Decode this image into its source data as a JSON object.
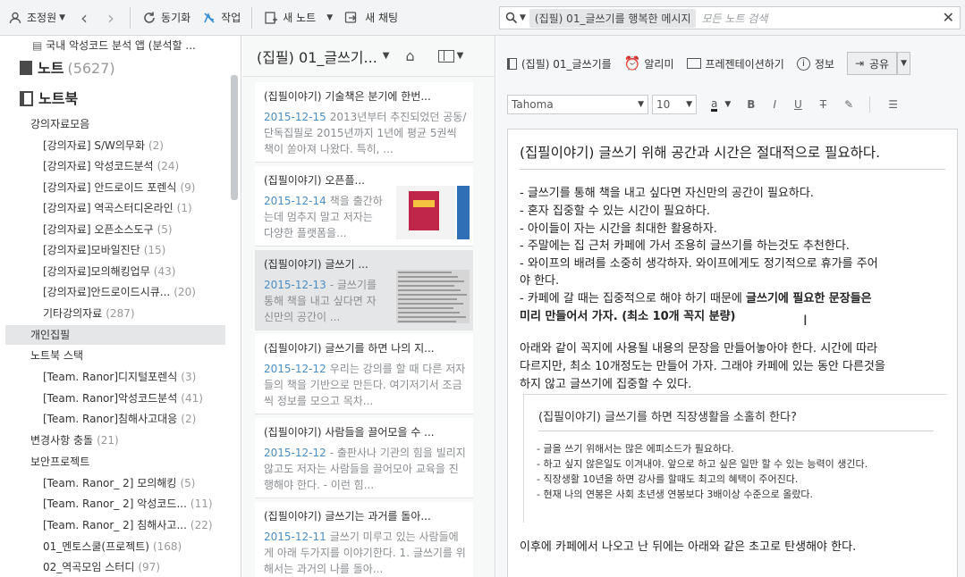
{
  "toolbar": {
    "user": "조정원",
    "sync": "동기화",
    "work": "작업",
    "new_note": "새 노트",
    "new_chat": "새 채팅",
    "search_chip": "(집필) 01_글쓰기를 행복한 메시지",
    "search_placeholder": "모든 노트 검색"
  },
  "sidebar": {
    "top_item": "국내 악성코드 분석 앱 (분석할 ...",
    "notes_label": "노트",
    "notes_count": "(5627)",
    "notebooks_label": "노트북",
    "items": [
      {
        "label": "강의자료모음",
        "count": ""
      },
      {
        "label": "[강의자료] S/W의무화",
        "count": "(2)"
      },
      {
        "label": "[강의자료] 악성코드분석",
        "count": "(24)"
      },
      {
        "label": "[강의자료] 안드로이드 포렌식",
        "count": "(9)"
      },
      {
        "label": "[강의자료] 역곡스터디온라인",
        "count": "(1)"
      },
      {
        "label": "[강의자료] 오픈소스도구",
        "count": "(5)"
      },
      {
        "label": "[강의자료]모바일진단",
        "count": "(15)"
      },
      {
        "label": "[강의자료]모의해킹업무",
        "count": "(43)"
      },
      {
        "label": "[강의자료]안드로이드시큐...",
        "count": "(20)"
      },
      {
        "label": "기타강의자료",
        "count": "(287)"
      },
      {
        "label": "개인집필",
        "count": ""
      },
      {
        "label": "노트북 스택",
        "count": ""
      },
      {
        "label": "[Team. Ranor]디지털포렌식",
        "count": "(3)"
      },
      {
        "label": "[Team. Ranor]악성코드분석",
        "count": "(41)"
      },
      {
        "label": "[Team. Ranor]침해사고대응",
        "count": "(2)"
      },
      {
        "label": "변경사항 충돌",
        "count": "(21)"
      },
      {
        "label": "보안프로젝트",
        "count": ""
      },
      {
        "label": "[Team. Ranor_ 2] 모의해킹",
        "count": "(5)"
      },
      {
        "label": "[Team. Ranor_ 2] 악성코드...",
        "count": "(11)"
      },
      {
        "label": "[Team. Ranor_ 2] 침해사고...",
        "count": "(22)"
      },
      {
        "label": "01_멘토스쿨(프로젝트)",
        "count": "(168)"
      },
      {
        "label": "02_역곡모임 스터디",
        "count": "(97)"
      }
    ]
  },
  "notelist": {
    "header": "(집필) 01_글쓰기...",
    "notes": [
      {
        "title": "(집필이야기) 기술책은 분기에 한번...",
        "date": "2015-12-15",
        "snippet": "2013년부터 추진되었던 공동/단독집필로 2015년까지 1년에 평균 5권씩 책이 쏟아져 나왔다. 특히, ..."
      },
      {
        "title": "(집필이야기) 오픈플...",
        "date": "2015-12-14",
        "snippet": "책을 출간하는데 멈추지 말고 저자는 다양한 플랫폼을..."
      },
      {
        "title": "(집필이야기) 글쓰기 ...",
        "date": "2015-12-13",
        "snippet": "- 글쓰기를 통해 책을 내고 싶다면 자신만의 공간이 ..."
      },
      {
        "title": "(집필이야기) 글쓰기를 하면 나의 지...",
        "date": "2015-12-12",
        "snippet": "우리는 강의를 할 때 다른 저자들의 책을 기반으로 만든다. 여기저기서 조금씩 정보를 모으고 목차..."
      },
      {
        "title": "(집필이야기) 사람들을 끌어모을 수 ...",
        "date": "2015-12-12",
        "snippet": "- 출판사나 기관의 힘을 빌리지 않고도 저자는 사람들을 끌어모아 교육을 진행해야 한다. - 이런 힘..."
      },
      {
        "title": "(집필이야기) 글쓰기는 과거를 돌아...",
        "date": "2015-12-11",
        "snippet": "글쓰기 미루고 있는 사람들에게 아래 두가지를 이야기한다. 1. 글쓰기를 위해서는 과거의 나를 돌아..."
      }
    ]
  },
  "editor": {
    "notebook": "(집필) 01_글쓰기를",
    "reminder": "알리미",
    "present": "프레젠테이션하기",
    "info": "정보",
    "share": "공유",
    "font": "Tahoma",
    "size": "10",
    "title": "(집필이야기) 글쓰기 위해 공간과 시간은 절대적으로 필요하다.",
    "bullets": [
      "- 글쓰기를 통해 책을 내고 싶다면 자신만의 공간이 필요하다.",
      "- 혼자 집중할 수 있는 시간이 필요하다.",
      "- 아이들이 자는 시간을 최대한 활용하자.",
      "- 주말에는 집 근처 카페에 가서 조용히 글쓰기를 하는것도 추천한다.",
      "- 와이프의 배려를 소중히 생각하자. 와이프에게도 정기적으로 휴가를 주어",
      "야 한다."
    ],
    "cafe_line1_a": "- 카페에 갈 때는 집중적으로 해야 하기 때문에 ",
    "cafe_line1_b": "글쓰기에 필요한 문장들은",
    "cafe_line2": "미리 만들어서 가자. (최소 10개 꼭지 분량)",
    "para": [
      "아래와 같이 꼭지에 사용될 내용의 문장을 만들어놓아야 한다. 시간에 따라",
      "다르지만, 최소 10개정도는 만들어 가자. 그래야 카페에 있는 동안 다른것을",
      "하지 않고 글쓰기에 집중할 수 있다."
    ],
    "embed_title": "(집필이야기) 글쓰기를 하면 직장생활을 소홀히 한다?",
    "embed_lines": [
      "- 글을 쓰기 위해서는 많은 에피소드가 필요하다.",
      "- 하고 싶지 않은일도 이겨내야. 앞으로 하고 싶은 일만 할 수 있는 능력이 생긴다.",
      "- 직장생활 10년을 하면 강사를 할때도 최고의 혜택이 주어진다.",
      "- 현재 나의 연봉은 사회 초년생 연봉보다 3배이상 수준으로 올랐다."
    ],
    "last_line": "이후에 카페에서 나오고 난 뒤에는 아래와 같은 초고로 탄생해야 한다."
  }
}
